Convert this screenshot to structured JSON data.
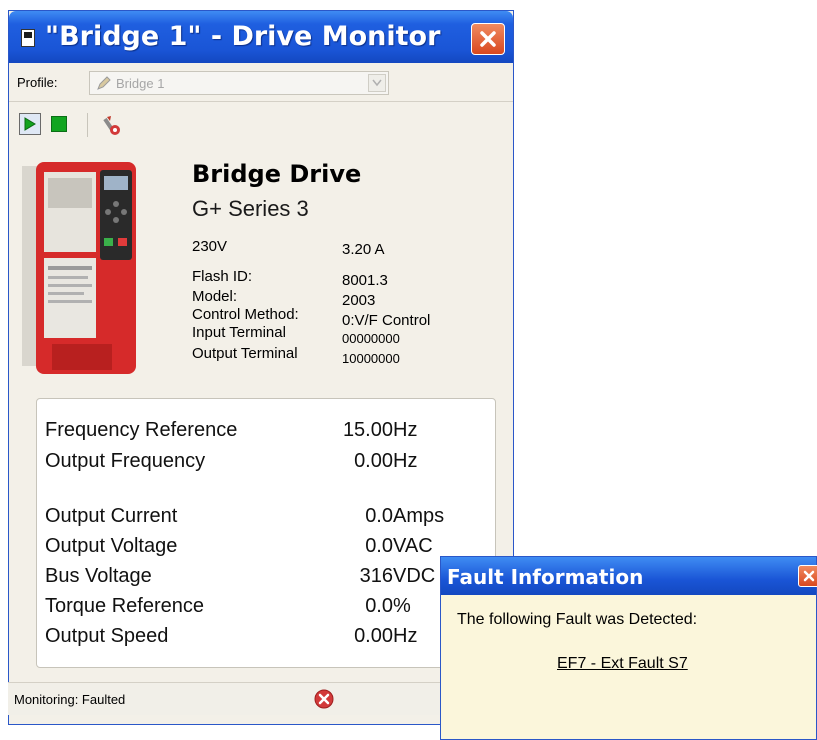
{
  "window": {
    "title": "\"Bridge 1\" - Drive Monitor",
    "close_icon": "close-icon"
  },
  "profile": {
    "label": "Profile:",
    "value": "Bridge 1",
    "icon": "pencil-icon"
  },
  "toolbar": {
    "play_icon": "play-icon",
    "stop_icon": "stop-icon",
    "tool_icon": "tool-icon"
  },
  "drive": {
    "name": "Bridge Drive",
    "series": "G+ Series 3",
    "voltage": "230V",
    "current": "3.20 A",
    "specs": [
      {
        "label": "Flash ID:",
        "value": "8001.3"
      },
      {
        "label": "Model:",
        "value": "2003"
      },
      {
        "label": "Control Method:",
        "value": "0:V/F Control"
      },
      {
        "label": "Input Terminal",
        "value": "00000000"
      },
      {
        "label": "Output Terminal",
        "value": "10000000"
      }
    ]
  },
  "readings": [
    {
      "label": "Frequency Reference",
      "value": "15.00",
      "unit": "Hz"
    },
    {
      "label": "Output Frequency",
      "value": "0.00",
      "unit": "Hz"
    },
    {
      "label": "Output Current",
      "value": "0.0",
      "unit": "Amps"
    },
    {
      "label": "Output Voltage",
      "value": "0.0",
      "unit": "VAC"
    },
    {
      "label": "Bus Voltage",
      "value": "316",
      "unit": "VDC"
    },
    {
      "label": "Torque Reference",
      "value": "0.0",
      "unit": "%"
    },
    {
      "label": "Output Speed",
      "value": "0.00",
      "unit": "Hz"
    }
  ],
  "status": {
    "text": "Monitoring:  Faulted",
    "icon": "error-icon"
  },
  "fault_dialog": {
    "title": "Fault Information",
    "message": "The following Fault was Detected:",
    "fault_link": "EF7 - Ext Fault S7"
  },
  "colors": {
    "titlebar": "#1a55d6",
    "close": "#d9481f",
    "status_error": "#d23a3a",
    "stop": "#11a520",
    "drive_body": "#d62a2a"
  }
}
